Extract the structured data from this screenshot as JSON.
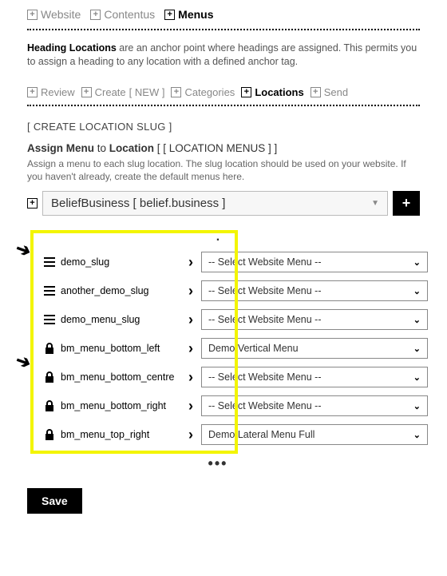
{
  "breadcrumb": [
    {
      "label": "Website",
      "active": false
    },
    {
      "label": "Contentus",
      "active": false
    },
    {
      "label": "Menus",
      "active": true
    }
  ],
  "intro_bold": "Heading Locations",
  "intro_rest": " are an anchor point where headings are assigned. This permits you to assign a heading to any location with a defined anchor tag.",
  "tabs": [
    {
      "label": "Review",
      "active": false,
      "suffix": ""
    },
    {
      "label": "Create",
      "active": false,
      "suffix": "[ NEW ]"
    },
    {
      "label": "Categories",
      "active": false,
      "suffix": ""
    },
    {
      "label": "Locations",
      "active": true,
      "suffix": ""
    },
    {
      "label": "Send",
      "active": false,
      "suffix": ""
    }
  ],
  "create_link": "[ CREATE LOCATION SLUG ]",
  "assign": {
    "b1": "Assign Menu",
    "mid": " to ",
    "b2": "Location",
    "suffix": " [ [ LOCATION MENUS ] ]"
  },
  "assign_sub": "Assign a menu to each slug location. The slug location should be used on your website. If you haven't already, create the default menus here.",
  "website_select": "BeliefBusiness [ belief.business ]",
  "add_label": "+",
  "rows": [
    {
      "icon": "hamburger",
      "name": "demo_slug",
      "menu": "-- Select Website Menu --"
    },
    {
      "icon": "hamburger",
      "name": "another_demo_slug",
      "menu": "-- Select Website Menu --"
    },
    {
      "icon": "hamburger",
      "name": "demo_menu_slug",
      "menu": "-- Select Website Menu --"
    },
    {
      "icon": "lock",
      "name": "bm_menu_bottom_left",
      "menu": "Demo Vertical Menu"
    },
    {
      "icon": "lock",
      "name": "bm_menu_bottom_centre",
      "menu": "-- Select Website Menu --"
    },
    {
      "icon": "lock",
      "name": "bm_menu_bottom_right",
      "menu": "-- Select Website Menu --"
    },
    {
      "icon": "lock",
      "name": "bm_menu_top_right",
      "menu": "Demo Lateral Menu Full"
    }
  ],
  "save": "Save"
}
